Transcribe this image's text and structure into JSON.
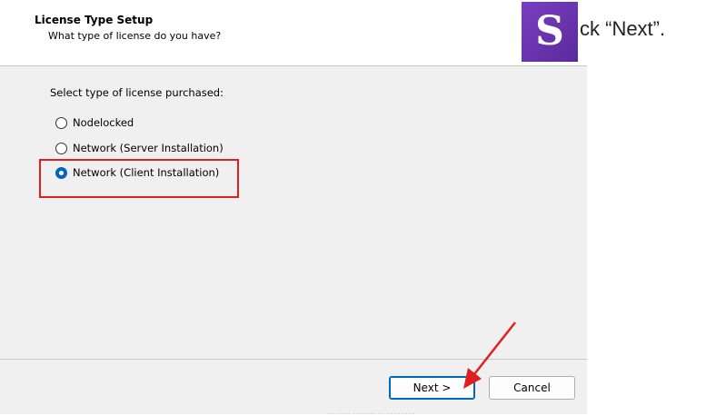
{
  "dialog": {
    "title": "License Type Setup",
    "subtitle": "What type of license do you have?",
    "prompt": "Select type of license purchased:",
    "options": [
      {
        "label": "Nodelocked",
        "selected": false
      },
      {
        "label": "Network (Server Installation)",
        "selected": false
      },
      {
        "label": "Network (Client Installation)",
        "selected": true
      }
    ],
    "buttons": {
      "next": "Next >",
      "cancel": "Cancel"
    }
  },
  "overlay": {
    "logo_letter": "S",
    "logo_color": "#6b35b0",
    "instruction": "ck “Next”.",
    "highlight_color": "#e02020",
    "footer_text": "… …… ……… … …………"
  }
}
